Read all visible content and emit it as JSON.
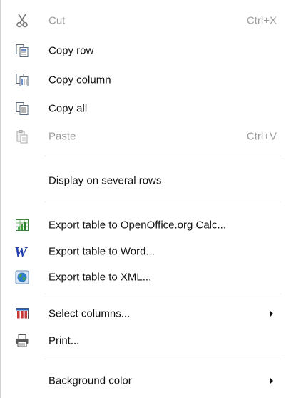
{
  "menu": {
    "items": [
      {
        "id": "cut",
        "label": "Cut",
        "shortcut": "Ctrl+X",
        "icon": "scissors-icon",
        "disabled": true
      },
      {
        "id": "copy-row",
        "label": "Copy row",
        "icon": "copy-row-icon",
        "disabled": false
      },
      {
        "id": "copy-column",
        "label": "Copy column",
        "icon": "copy-column-icon",
        "disabled": false
      },
      {
        "id": "copy-all",
        "label": "Copy all",
        "icon": "copy-all-icon",
        "disabled": false
      },
      {
        "id": "paste",
        "label": "Paste",
        "shortcut": "Ctrl+V",
        "icon": "paste-icon",
        "disabled": true
      },
      {
        "id": "display-several-rows",
        "label": "Display on several rows",
        "disabled": false
      },
      {
        "id": "export-calc",
        "label": "Export table to OpenOffice.org Calc...",
        "icon": "spreadsheet-icon",
        "disabled": false
      },
      {
        "id": "export-word",
        "label": "Export table to Word...",
        "icon": "word-icon",
        "disabled": false
      },
      {
        "id": "export-xml",
        "label": "Export table to XML...",
        "icon": "globe-icon",
        "disabled": false
      },
      {
        "id": "select-columns",
        "label": "Select columns...",
        "icon": "columns-icon",
        "submenu": true,
        "disabled": false
      },
      {
        "id": "print",
        "label": "Print...",
        "icon": "printer-icon",
        "disabled": false
      },
      {
        "id": "background-color",
        "label": "Background color",
        "submenu": true,
        "disabled": false
      }
    ]
  },
  "colors": {
    "text": "#111111",
    "disabled_text": "#9a9a9a",
    "separator": "#e3e3e3",
    "word_blue": "#1f3fae",
    "calc_green": "#3a9a3a",
    "columns_red": "#c63a3a",
    "columns_blue": "#2a63b5"
  }
}
